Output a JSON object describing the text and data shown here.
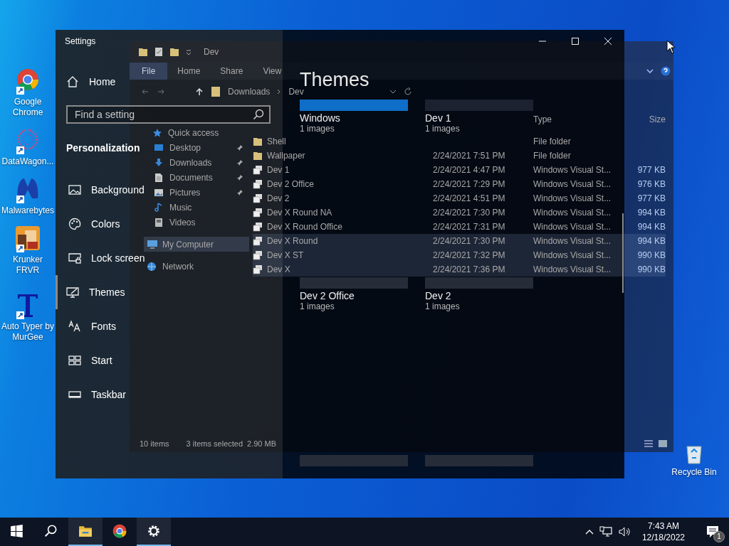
{
  "desktop": {
    "icons": [
      {
        "label": "Google Chrome",
        "kind": "chrome"
      },
      {
        "label": "DataWagon...",
        "kind": "datawagon"
      },
      {
        "label": "Malwarebytes",
        "kind": "malwarebytes"
      },
      {
        "label": "Krunker FRVR",
        "kind": "krunker"
      },
      {
        "label": "Auto Typer by MurGee",
        "kind": "autotyper"
      }
    ],
    "recycle_bin": {
      "label": "Recycle Bin"
    }
  },
  "explorer": {
    "title": "Dev",
    "ribbon_tabs": [
      {
        "label": "File",
        "selected": true
      },
      {
        "label": "Home",
        "selected": false
      },
      {
        "label": "Share",
        "selected": false
      },
      {
        "label": "View",
        "selected": false
      }
    ],
    "breadcrumb": [
      "Downloads",
      "Dev"
    ],
    "nav": [
      {
        "label": "Quick access",
        "kind": "star",
        "selected": false,
        "pinned": false,
        "children": [
          {
            "label": "Desktop",
            "kind": "desktop",
            "selected": false,
            "pinned": true
          },
          {
            "label": "Downloads",
            "kind": "download",
            "selected": false,
            "pinned": true
          },
          {
            "label": "Documents",
            "kind": "document",
            "selected": false,
            "pinned": true
          },
          {
            "label": "Pictures",
            "kind": "picture",
            "selected": false,
            "pinned": true
          },
          {
            "label": "Music",
            "kind": "music",
            "selected": false,
            "pinned": false
          },
          {
            "label": "Videos",
            "kind": "video",
            "selected": false,
            "pinned": false
          }
        ]
      },
      {
        "label": "My Computer",
        "kind": "computer",
        "selected": true,
        "pinned": false
      },
      {
        "label": "Network",
        "kind": "network",
        "selected": false,
        "pinned": false
      }
    ],
    "columns": [
      "Type",
      "Size"
    ],
    "files": [
      {
        "name": "Shell",
        "kind": "folder",
        "type": "File folder",
        "selected": false
      },
      {
        "name": "Wallpaper",
        "kind": "folder",
        "date": "2/24/2021 7:51 PM",
        "type": "File folder",
        "selected": false
      },
      {
        "name": "Dev 1",
        "kind": "theme",
        "date": "2/24/2021 4:47 PM",
        "type": "Windows Visual St...",
        "size": "977 KB",
        "selected": false
      },
      {
        "name": "Dev 2 Office",
        "kind": "theme",
        "date": "2/24/2021 7:29 PM",
        "type": "Windows Visual St...",
        "size": "976 KB",
        "selected": false
      },
      {
        "name": "Dev 2",
        "kind": "theme",
        "date": "2/24/2021 4:51 PM",
        "type": "Windows Visual St...",
        "size": "977 KB",
        "selected": false
      },
      {
        "name": "Dev X Round NA",
        "kind": "theme",
        "date": "2/24/2021 7:30 PM",
        "type": "Windows Visual St...",
        "size": "994 KB",
        "selected": false
      },
      {
        "name": "Dev X Round Office",
        "kind": "theme",
        "date": "2/24/2021 7:31 PM",
        "type": "Windows Visual St...",
        "size": "994 KB",
        "selected": false
      },
      {
        "name": "Dev X Round",
        "kind": "theme",
        "date": "2/24/2021 7:30 PM",
        "type": "Windows Visual St...",
        "size": "994 KB",
        "selected": true
      },
      {
        "name": "Dev X ST",
        "kind": "theme",
        "date": "2/24/2021 7:32 PM",
        "type": "Windows Visual St...",
        "size": "990 KB",
        "selected": true
      },
      {
        "name": "Dev X",
        "kind": "theme",
        "date": "2/24/2021 7:36 PM",
        "type": "Windows Visual St...",
        "size": "990 KB",
        "selected": true
      }
    ],
    "status": {
      "count": "10 items",
      "selection": "3 items selected",
      "size": "2.90 MB"
    }
  },
  "settings": {
    "title": "Settings",
    "home": "Home",
    "search": {
      "placeholder": "Find a setting"
    },
    "section": "Personalization",
    "items": [
      {
        "label": "Background",
        "selected": false
      },
      {
        "label": "Colors",
        "selected": false
      },
      {
        "label": "Lock screen",
        "selected": false
      },
      {
        "label": "Themes",
        "selected": true
      },
      {
        "label": "Fonts",
        "selected": false
      },
      {
        "label": "Start",
        "selected": false
      },
      {
        "label": "Taskbar",
        "selected": false
      }
    ],
    "page_title": "Themes",
    "themes": [
      {
        "name": "Windows",
        "count": "1 images",
        "color": "#0f6ec8"
      },
      {
        "name": "Dev 1",
        "count": "1 images",
        "color": "#1c2230"
      },
      {
        "name": "Dev 2 Office",
        "count": "1 images",
        "color": "#262c38"
      },
      {
        "name": "Dev 2",
        "count": "1 images",
        "color": "#262c38"
      },
      {
        "color": "#262c38"
      },
      {
        "color": "#262c38"
      }
    ]
  },
  "taskbar": {
    "apps": [
      {
        "kind": "start",
        "active": false
      },
      {
        "kind": "search",
        "active": false
      },
      {
        "kind": "explorer",
        "active": true
      },
      {
        "kind": "chrome",
        "active": false
      },
      {
        "kind": "settings",
        "active": true
      }
    ],
    "time": "7:43 AM",
    "date": "12/18/2022",
    "notifications": "1"
  }
}
